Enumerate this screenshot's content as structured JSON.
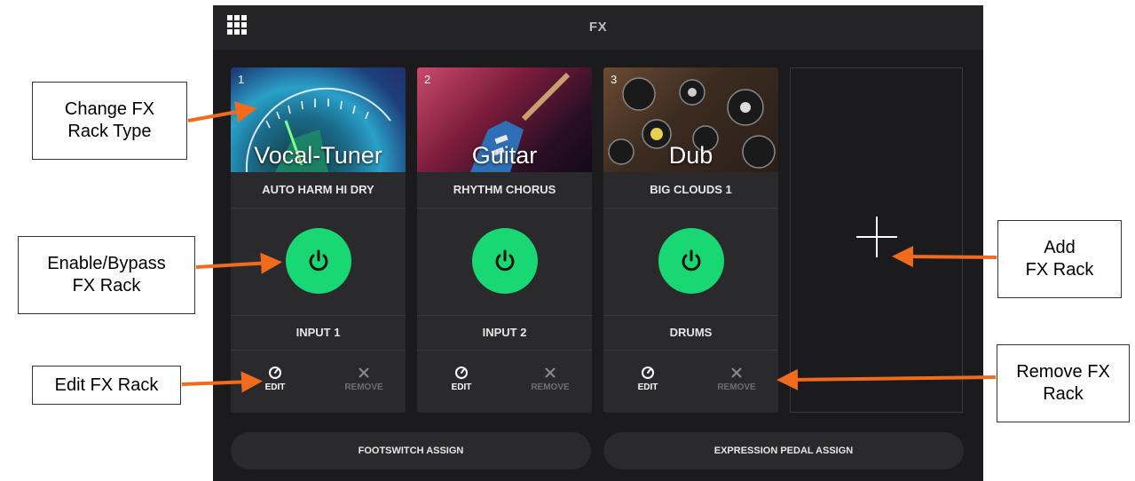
{
  "header": {
    "title": "FX",
    "menu_icon": "grid-menu-icon"
  },
  "racks": [
    {
      "number": "1",
      "type": "Vocal-Tuner",
      "preset": "AUTO HARM HI DRY",
      "input": "INPUT 1",
      "enabled": true,
      "edit_label": "EDIT",
      "remove_label": "REMOVE"
    },
    {
      "number": "2",
      "type": "Guitar",
      "preset": "RHYTHM CHORUS",
      "input": "INPUT 2",
      "enabled": true,
      "edit_label": "EDIT",
      "remove_label": "REMOVE"
    },
    {
      "number": "3",
      "type": "Dub",
      "preset": "BIG CLOUDS 1",
      "input": "DRUMS",
      "enabled": true,
      "edit_label": "EDIT",
      "remove_label": "REMOVE"
    }
  ],
  "add_rack_icon": "plus-icon",
  "footer": {
    "footswitch_label": "FOOTSWITCH ASSIGN",
    "expression_label": "EXPRESSION PEDAL ASSIGN"
  },
  "callouts": {
    "change_type": [
      "Change FX",
      "Rack Type"
    ],
    "enable_bypass": [
      "Enable/Bypass",
      "FX Rack"
    ],
    "edit": [
      "Edit FX Rack"
    ],
    "add": [
      "Add",
      "FX Rack"
    ],
    "remove": [
      "Remove FX",
      "Rack"
    ]
  },
  "colors": {
    "power_on": "#19d873",
    "arrow": "#f26b1d",
    "screen_bg": "#1b1b1d",
    "panel_bg": "#2a2a2d"
  }
}
